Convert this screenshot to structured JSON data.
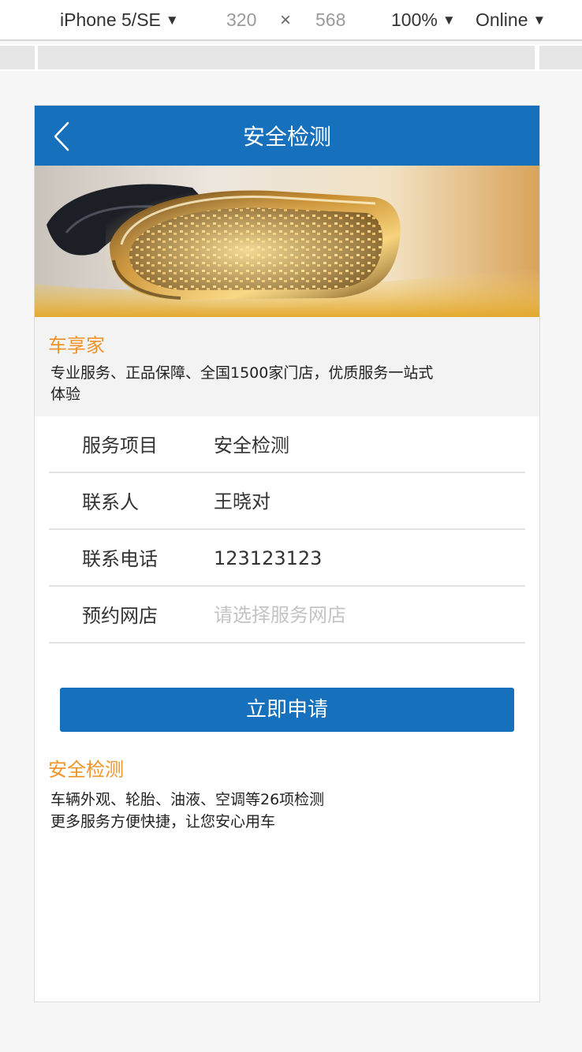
{
  "devtools": {
    "device": "iPhone 5/SE",
    "width": "320",
    "times": "×",
    "height": "568",
    "zoom": "100%",
    "network": "Online",
    "caret": "▼"
  },
  "header": {
    "title": "安全检测",
    "back_icon": "chevron-left-icon"
  },
  "intro": {
    "title": "车享家",
    "text": "专业服务、正品保障、全国1500家门店，优质服务一站式体验"
  },
  "form": {
    "rows": [
      {
        "label": "服务项目",
        "value": "安全检测",
        "placeholder": ""
      },
      {
        "label": "联系人",
        "value": "王晓对",
        "placeholder": ""
      },
      {
        "label": "联系电话",
        "value": "123123123",
        "placeholder": ""
      },
      {
        "label": "预约网店",
        "value": "",
        "placeholder": "请选择服务网店"
      }
    ]
  },
  "apply_button": "立即申请",
  "service": {
    "title": "安全检测",
    "lines": [
      "车辆外观、轮胎、油液、空调等26项检测",
      "更多服务方便快捷，让您安心用车"
    ]
  },
  "colors": {
    "brand_blue": "#1670bc",
    "accent_orange": "#f0942a"
  }
}
